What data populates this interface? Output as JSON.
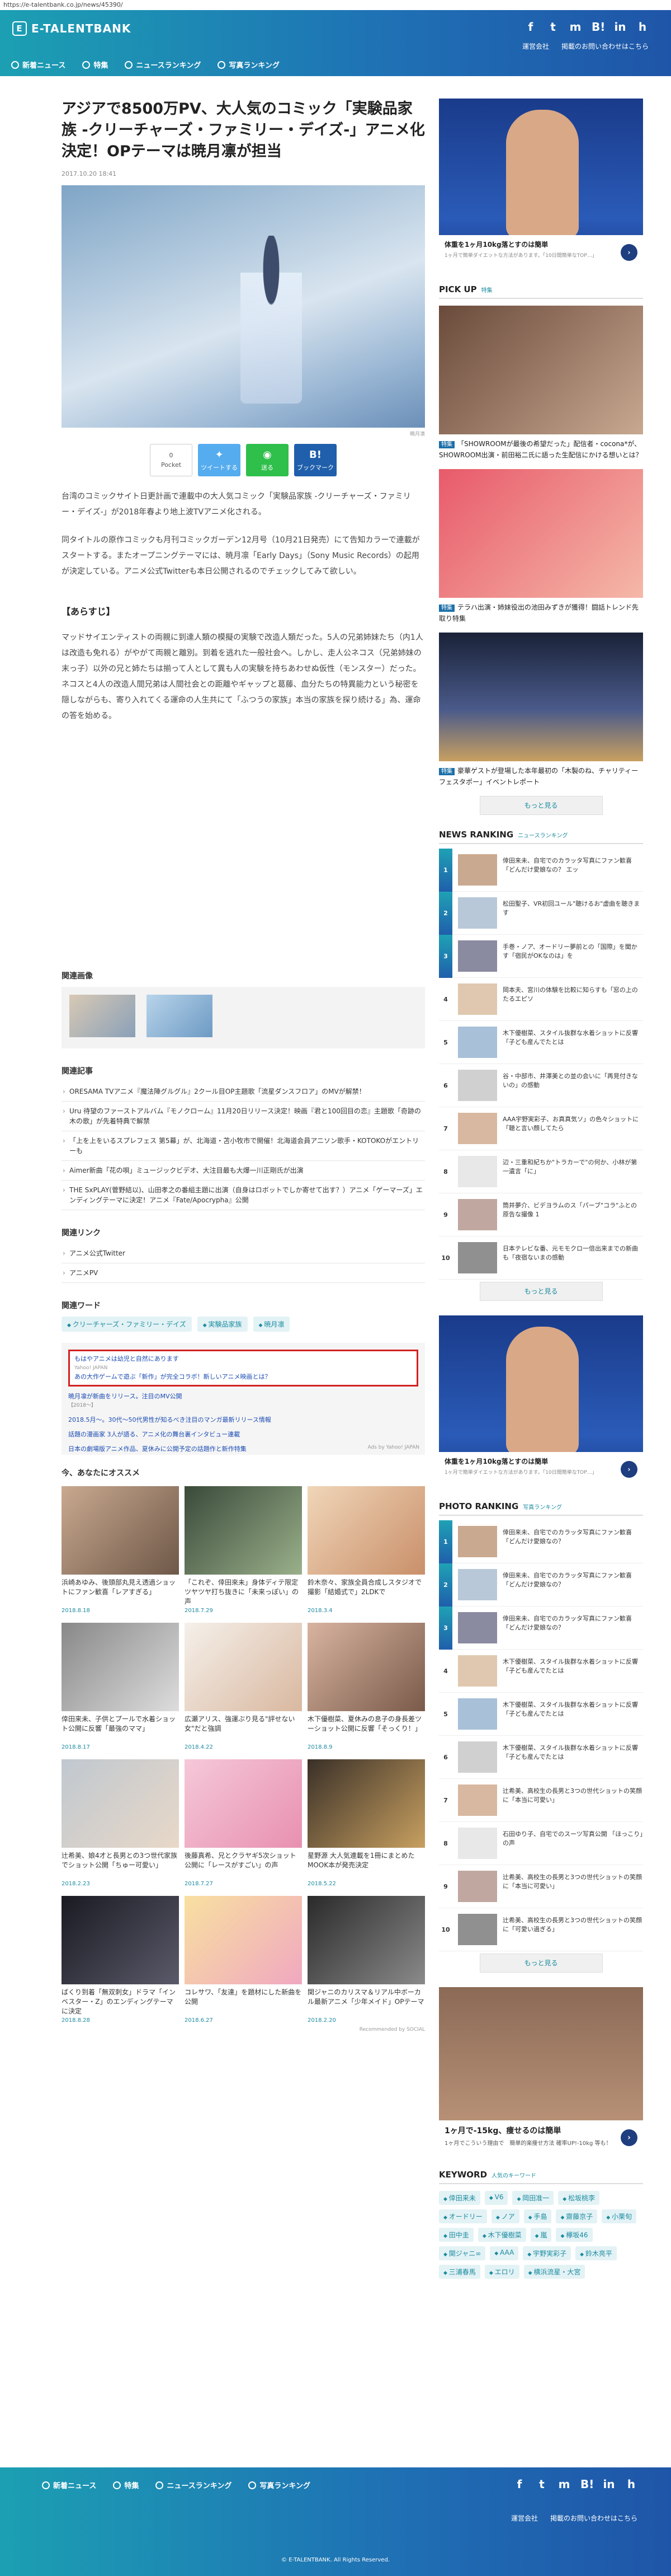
{
  "browser": {
    "url": "https://e-talentbank.co.jp/news/45390/"
  },
  "header": {
    "logo_text": "E-TALENTBANK",
    "logo_mark": "E",
    "social_icons": [
      "f",
      "t",
      "m",
      "B!",
      "in",
      "h"
    ],
    "links": [
      "運営会社",
      "掲載のお問い合わせはこちら"
    ],
    "nav": [
      "新着ニュース",
      "特集",
      "ニュースランキング",
      "写真ランキング"
    ]
  },
  "article": {
    "title": "アジアで8500万PV、大人気のコミック「実験品家族 -クリーチャーズ・ファミリー・デイズ-」アニメ化決定！OPテーマは暁月凛が担当",
    "date": "2017.10.20 18:41",
    "image_credit": "暁月凛",
    "share": {
      "pocket_count": "0",
      "pocket_label": "Pocket",
      "twitter_label": "ツイートする",
      "line_label": "送る",
      "hatena_label": "ブックマーク"
    },
    "paragraphs": [
      "台湾のコミックサイト日更計画で連載中の大人気コミック「実験品家族 -クリーチャーズ・ファミリー・デイズ-」が2018年春より地上波TVアニメ化される。",
      "同タイトルの原作コミックも月刊コミックガーデン12月号（10月21日発売）にて告知カラーで連載がスタートする。またオープニングテーマには、暁月凛「Early Days」（Sony Music Records）の起用が決定している。アニメ公式Twitterも本日公開されるのでチェックしてみて欲しい。"
    ],
    "synopsis_heading": "【あらすじ】",
    "synopsis": "マッドサイエンティストの両親に到達人類の模擬の実験で改造人類だった。5人の兄弟姉妹たち（内1人は改造も免れる）がやがて両親と離別。到着を逃れた一般社会へ。しかし、走人公ネコス（兄弟姉妹の末っ子）以外の兄と姉たちは揃って人として異も人の実験を持ちあわせぬ仮性（モンスター）だった。ネコスと4人の改造人間兄弟は人間社会との距離やギャップと葛藤、血分たちの特異能力という秘密を隠しながらも、寄り入れてくる運命の人生共にて「ふつうの家族」本当の家族を探り続ける」為、運命の答を始める。"
  },
  "related": {
    "images_heading": "関連画像",
    "articles_heading": "関連記事",
    "articles": [
      "ORESAMA TVアニメ『魔法陣グルグル』2クール目OP主題歌「流星ダンスフロア」のMVが解禁！",
      "Uru 待望のファーストアルバム『モノクローム』11月20日リリース決定！映画『君と100回目の恋』主題歌「奇跡の木の歌」が先着特典で解禁",
      "「上を上をいるスプレフェス 第5幕」が、北海道・苫小牧市で開催！北海道会員アニソン歌手・KOTOKOがエントリーも",
      "Aimer新曲「花の唄」ミュージックビデオ、大注目最も大爆一川正剛氏が出演",
      "THE SxPLAY(菅野結以)、山田孝之の番組主題に出演（自身はロボットでしか寄せて出す？）アニメ「ゲーマーズ」エンディングテーマに決定！アニメ『Fate/Apocrypha』公開"
    ],
    "links_heading": "関連リンク",
    "links": [
      "アニメ公式Twitter",
      "アニメPV"
    ],
    "words_heading": "関連ワード",
    "words": [
      "クリーチャーズ・ファミリー・デイズ",
      "実験品家族",
      "暁月凛"
    ]
  },
  "ads_box": {
    "highlight_title": "もはやアニメは幼児と自然にあります",
    "highlight_src": "Yahoo! JAPAN",
    "highlight_sub": "あの大作ゲームで遊ぶ「新作」が完全コラボ！新しいアニメ映画とは？",
    "line1": "暁月凛が新曲をリリース。注目のMV公開",
    "line1_src": "【2018〜】",
    "line2": "2018.5月〜。30代〜50代男性が知るべき注目のマンガ最新リリース情報",
    "line3": "話題の漫画家 3人が語る、アニメ化の舞台裏インタビュー連載",
    "line4": "日本の劇場版アニメ作品、夏休みに公開予定の話題作と新作特集",
    "by": "Ads by Yahoo! JAPAN"
  },
  "recommend": {
    "heading": "今、あなたにオススメ",
    "items": [
      {
        "title": "浜崎あゆみ、後頭部丸見え透過ショットにファン歓喜「レアすぎる」",
        "date": "2018.8.18"
      },
      {
        "title": "「これぞ、倖田來未」身体ディテ限定ツヤツヤ打ち抜きに「未来っぽい」の声",
        "date": "2018.7.29"
      },
      {
        "title": "鈴木奈々、家族全員合成しスタジオで撮影「結婚式で」2LDKで",
        "date": "2018.3.4"
      },
      {
        "title": "倖田来未、子供とプールで水着ショット公開に反響「最強のママ」",
        "date": "2018.8.17"
      },
      {
        "title": "広瀬アリス、強運ぶり見る\"評せない女\"だと強調",
        "date": "2018.4.22"
      },
      {
        "title": "木下優樹菜、夏休みの息子の身長差ツーショット公開に反響「そっくり！」",
        "date": "2018.8.9"
      },
      {
        "title": "辻希美、娘4才と長男との3つ世代家族でショット公開「ちゅー可愛い」",
        "date": "2018.2.23"
      },
      {
        "title": "後藤真希、兄とクラヤギ5次ショット公開に「レースがすごい」の声",
        "date": "2018.7.27"
      },
      {
        "title": "星野源 大人気連載を1冊にまとめたMOOK本が発売決定",
        "date": "2018.5.22"
      },
      {
        "title": "ばくり到着「無双刺女」ドラマ「インベスター・Z」のエンディングテーマに決定",
        "date": "2018.8.28"
      },
      {
        "title": "コレサワ、「友達」を題材にした新曲を公開",
        "date": "2018.6.27"
      },
      {
        "title": "関ジャニのカリスマ＆リアル中ボーカル最新アニメ「少年メイド」OPテーマ",
        "date": "2018.2.20"
      }
    ],
    "by": "Recommended by SOCIAL"
  },
  "sidebar": {
    "ad_top": {
      "title": "体重を1ヶ月10kg落とすのは簡単",
      "sub": "1ヶ月で簡単ダイエットな方法があります。「10日間簡単なTOP…」"
    },
    "pickup_heading": "PICK UP",
    "pickup_sub": "特集",
    "pickup_badge": "特集",
    "pickup": [
      "「SHOWROOMが最後の希望だった」配信者・cocona*が、SHOWROOM出演・前田裕二氏に語った生配信にかける想いとは？",
      "テラハ出演・姉妹役出の池田みずきが獲得！闘話トレンド先取り特集",
      "豪華ゲストが登場した本年最初の「木製のね、チャリティーフェスタポー」イベントレポート"
    ],
    "more_label": "もっと見る",
    "news_ranking_heading": "NEWS RANKING",
    "news_ranking_sub": "ニュースランキング",
    "news_ranking": [
      "倖田来未、自宅でのカラッタ写真にファン歓喜「どんだけ愛娘なの？ エッ",
      "松田聖子、VR初回ユール\"聴けるお\"虚曲を聴きます",
      "手巻・ノア、オードリー夢前との「国際」を聞かす「宿民がOKなのは」を",
      "岡本夫、宮川の体験を比較に知らすも「窓の上のたるエピソ",
      "木下優樹菜、スタイル抜群な水着ショットに反響「子ども産んでたとは",
      "谷・中部市、井澤美との並の会いに「再見付きないの」の感動",
      "AAA宇野実彩子、お真真気ソ」の色々ショットに「聴と言い顔してたら",
      "辺・三重和紀ちか\"トラカーで\"の何か、小林が第一遺言「に」",
      "筒井夢介、ビデヨラムのス「パーブ\"コラ\"ふとの原告な撮像 1",
      "日本テレビな番、元モモクロ一倍出来までの新曲も「夜宿ないまの感動"
    ],
    "photo_ranking_heading": "PHOTO RANKING",
    "photo_ranking_sub": "写真ランキング",
    "photo_ranking": [
      "倖田来未、自宅でのカラッタ写真にファン歓喜「どんだけ愛娘なの？",
      "倖田来未、自宅でのカラッタ写真にファン歓喜「どんだけ愛娘なの？",
      "倖田来未、自宅でのカラッタ写真にファン歓喜「どんだけ愛娘なの？",
      "木下優樹菜、スタイル抜群な水着ショットに反響「子ども産んでたとは",
      "木下優樹菜、スタイル抜群な水着ショットに反響「子ども産んでたとは",
      "木下優樹菜、スタイル抜群な水着ショットに反響「子ども産んでたとは",
      "辻希美、高校生の長男と3つの世代ショットの笑顔に「本当に可愛い」",
      "石田ゆり子、自宅でのスーツ写真公開 「ほっこり」の声",
      "辻希美、高校生の長男と3つの世代ショットの笑顔に「本当に可愛い」",
      "辻希美、高校生の長男と3つの世代ショットの笑顔に「可愛い過ぎる」"
    ],
    "ad_bottom": {
      "title": "1ヶ月で-15kg、痩せるのは簡単",
      "sub": "1ヶ月でこういう理由で　簡単的楽痩せ方法 確率UP!-10kg 等も！"
    },
    "keyword_heading": "KEYWORD",
    "keyword_sub": "人気のキーワード",
    "keywords": [
      "倖田来未",
      "V6",
      "岡田准一",
      "松坂桃李",
      "オードリー",
      "ノア",
      "手島",
      "齋藤京子",
      "小栗旬",
      "田中圭",
      "木下優樹菜",
      "嵐",
      "欅坂46",
      "関ジャニ∞",
      "AAA",
      "宇野実彩子",
      "鈴木亮平",
      "三浦春馬",
      "エロリ",
      "横浜流星・大宮"
    ]
  },
  "footer": {
    "nav": [
      "新着ニュース",
      "特集",
      "ニュースランキング",
      "写真ランキング"
    ],
    "social_icons": [
      "f",
      "t",
      "m",
      "B!",
      "in",
      "h"
    ],
    "links": [
      "運営会社",
      "掲載のお問い合わせはこちら"
    ],
    "copyright": "© E-TALENTBANK. All Rights Reserved."
  },
  "colors": {
    "brand_teal": "#1c9fb3",
    "brand_blue": "#1f55a8",
    "tag_text": "#1b8ba0",
    "ad_highlight": "#d42020"
  }
}
